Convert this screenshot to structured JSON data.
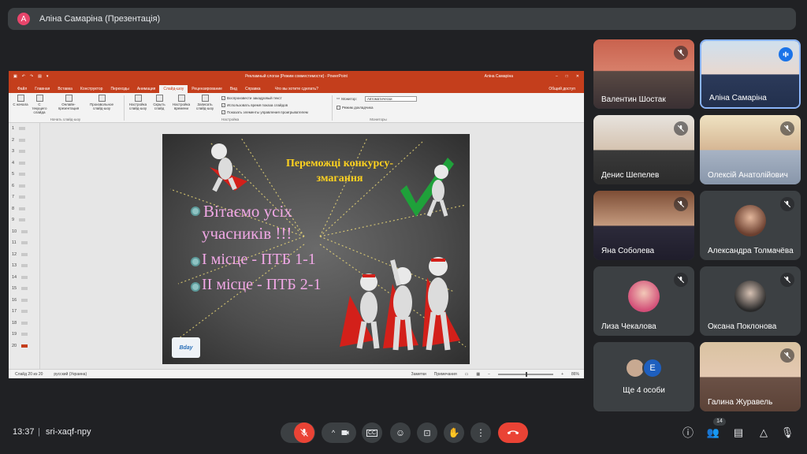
{
  "presenter": {
    "initial": "A",
    "title": "Аліна Самаріна (Презентація)"
  },
  "powerpoint": {
    "window_title": "Рекламный слоган [Режим совместимости] - PowerPoint",
    "user": "Аліна Самаріна",
    "tabs": [
      "Файл",
      "Главная",
      "Вставка",
      "Конструктор",
      "Переходы",
      "Анимация",
      "Слайд-шоу",
      "Рецензирование",
      "Вид",
      "Справка"
    ],
    "active_tab": "Слайд-шоу",
    "tell_me": "Что вы хотите сделать?",
    "share": "Общий доступ",
    "ribbon": {
      "buttons": [
        "С начала",
        "С текущего слайда",
        "Онлайн-презентация",
        "Произвольное слайд-шоу",
        "Настройка слайд-шоу",
        "Скрыть слайд",
        "Настройка времени",
        "Записать слайд-шоу"
      ],
      "group_start": "Начать слайд-шоу",
      "group_setup": "Настройка",
      "group_monitors": "Мониторы",
      "checks": [
        "Воспроизвести закадровый текст",
        "Использовать время показа слайдов",
        "Показать элементы управления проигрывателем"
      ],
      "monitor_label": "Монитор:",
      "monitor_value": "Автоматически",
      "presenter_view": "Режим докладчика"
    },
    "slide_numbers": [
      "1",
      "2",
      "3",
      "4",
      "5",
      "6",
      "7",
      "8",
      "9",
      "10",
      "11",
      "12",
      "13",
      "14",
      "15",
      "16",
      "17",
      "18",
      "19",
      "20"
    ],
    "active_slide": "20",
    "status": {
      "slide": "Слайд 20 из 20",
      "lang": "русский (Украина)",
      "notes": "Заметки",
      "comments": "Примечания",
      "zoom": "86%"
    }
  },
  "slide": {
    "title": "Переможці конкурсу-змагання",
    "greeting_line1": "Вітаємо усіх",
    "greeting_line2": "учасників !!!",
    "place1": "І місце  - ПТБ 1-1",
    "place2": "ІІ місце -  ПТБ 2-1",
    "logo_text": "Bday"
  },
  "participants": [
    {
      "name": "Валентин Шостак",
      "muted": true
    },
    {
      "name": "Аліна Самаріна",
      "muted": false,
      "speaking": true
    },
    {
      "name": "Денис Шепелев",
      "muted": true
    },
    {
      "name": "Олексій Анатолійович",
      "muted": true
    },
    {
      "name": "Яна Соболева",
      "muted": true
    },
    {
      "name": "Александра Толмачёва",
      "muted": true
    },
    {
      "name": "Лиза Чекалова",
      "muted": true
    },
    {
      "name": "Оксана Поклонова",
      "muted": true
    },
    {
      "name": "Ще 4 особи",
      "extra_initial": "E"
    },
    {
      "name": "Галина Журавель",
      "muted": true
    }
  ],
  "bottom": {
    "time": "13:37",
    "separator": "|",
    "meeting_code": "sri-xaqf-npy",
    "participants_count": "14"
  },
  "colors": {
    "background": "#202124",
    "tile": "#3c4043",
    "danger": "#ea4335",
    "accent": "#8ab4f8",
    "ppt_red": "#c43e1c",
    "slide_title": "#ffd21f",
    "slide_text": "#f1a8e6"
  }
}
